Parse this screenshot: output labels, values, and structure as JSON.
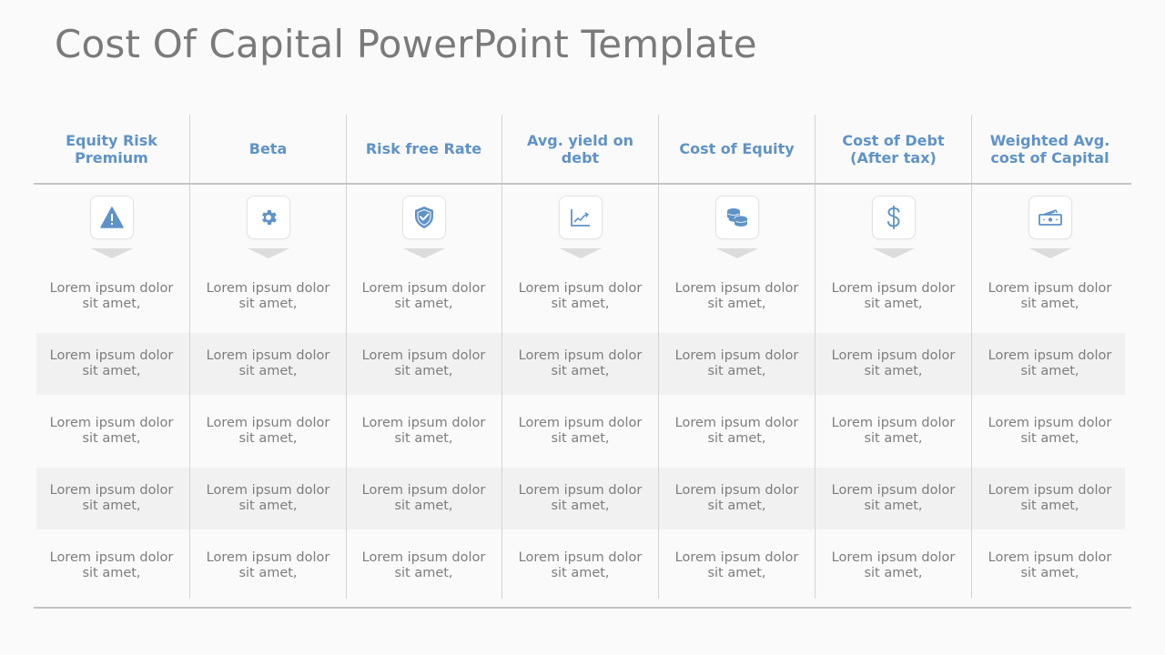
{
  "title": "Cost Of Capital PowerPoint Template",
  "accent_color": "#5f93c8",
  "columns": [
    {
      "header": "Equity Risk Premium",
      "icon": "warning-icon"
    },
    {
      "header": "Beta",
      "icon": "gear-icon"
    },
    {
      "header": "Risk free Rate",
      "icon": "shield-check-icon"
    },
    {
      "header": "Avg. yield on debt",
      "icon": "line-chart-icon"
    },
    {
      "header": "Cost of Equity",
      "icon": "coins-icon"
    },
    {
      "header": "Cost of Debt (After tax)",
      "icon": "dollar-icon"
    },
    {
      "header": "Weighted Avg. cost of Capital",
      "icon": "cash-icon"
    }
  ],
  "rows": [
    [
      "Lorem ipsum dolor sit amet,",
      "Lorem ipsum dolor sit amet,",
      "Lorem ipsum dolor sit amet,",
      "Lorem ipsum dolor sit amet,",
      "Lorem ipsum dolor sit amet,",
      "Lorem ipsum dolor sit amet,",
      "Lorem ipsum dolor sit amet,"
    ],
    [
      "Lorem ipsum dolor sit amet,",
      "Lorem ipsum dolor sit amet,",
      "Lorem ipsum dolor sit amet,",
      "Lorem ipsum dolor sit amet,",
      "Lorem ipsum dolor sit amet,",
      "Lorem ipsum dolor sit amet,",
      "Lorem ipsum dolor sit amet,"
    ],
    [
      "Lorem ipsum dolor sit amet,",
      "Lorem ipsum dolor sit amet,",
      "Lorem ipsum dolor sit amet,",
      "Lorem ipsum dolor sit amet,",
      "Lorem ipsum dolor sit amet,",
      "Lorem ipsum dolor sit amet,",
      "Lorem ipsum dolor sit amet,"
    ],
    [
      "Lorem ipsum dolor sit amet,",
      "Lorem ipsum dolor sit amet,",
      "Lorem ipsum dolor sit amet,",
      "Lorem ipsum dolor sit amet,",
      "Lorem ipsum dolor sit amet,",
      "Lorem ipsum dolor sit amet,",
      "Lorem ipsum dolor sit amet,"
    ],
    [
      "Lorem ipsum dolor sit amet,",
      "Lorem ipsum dolor sit amet,",
      "Lorem ipsum dolor sit amet,",
      "Lorem ipsum dolor sit amet,",
      "Lorem ipsum dolor sit amet,",
      "Lorem ipsum dolor sit amet,",
      "Lorem ipsum dolor sit amet,"
    ]
  ]
}
